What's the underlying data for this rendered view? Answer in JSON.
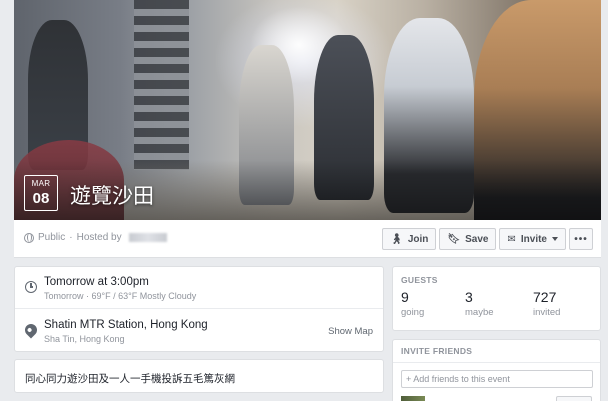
{
  "event": {
    "month": "MAR",
    "day": "08",
    "title": "遊覽沙田",
    "privacy": "Public",
    "hosted_by_label": "Hosted by"
  },
  "actions": {
    "join": "Join",
    "save": "Save",
    "invite": "Invite",
    "more": "•••"
  },
  "details": {
    "time_main": "Tomorrow at 3:00pm",
    "time_sub": "Tomorrow · 69°F / 63°F Mostly Cloudy",
    "place_main": "Shatin MTR Station, Hong Kong",
    "place_sub": "Sha Tin, Hong Kong",
    "show_map": "Show Map",
    "description": "同心同力遊沙田及一人一手機投訴五毛篤灰網"
  },
  "guests": {
    "heading": "GUESTS",
    "going_count": "9",
    "going_label": "going",
    "maybe_count": "3",
    "maybe_label": "maybe",
    "invited_count": "727",
    "invited_label": "invited"
  },
  "invite_friends": {
    "heading": "INVITE FRIENDS",
    "placeholder": "+ Add friends to this event"
  },
  "icons": [
    "globe-icon",
    "clock-icon",
    "location-pin-icon",
    "join-icon",
    "bookmark-icon",
    "envelope-icon",
    "caret-down-icon"
  ]
}
